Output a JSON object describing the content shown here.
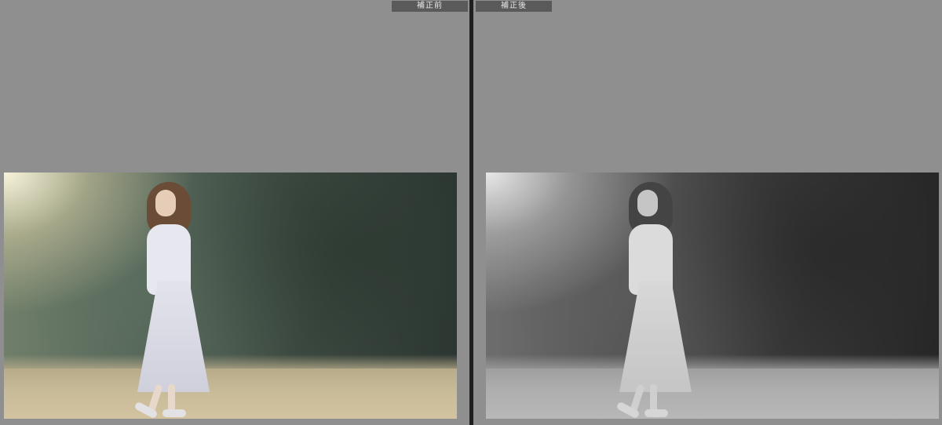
{
  "panels": {
    "before_label": "補正前",
    "after_label": "補正後"
  },
  "colors": {
    "canvas_bg": "#8f8f8f",
    "divider": "#1f1f1f",
    "label_bg": "#5a5a5a",
    "label_text": "#e8e8e8"
  },
  "icons": {
    "before_photo": "portrait-photo-color",
    "after_photo": "portrait-photo-monochrome"
  }
}
